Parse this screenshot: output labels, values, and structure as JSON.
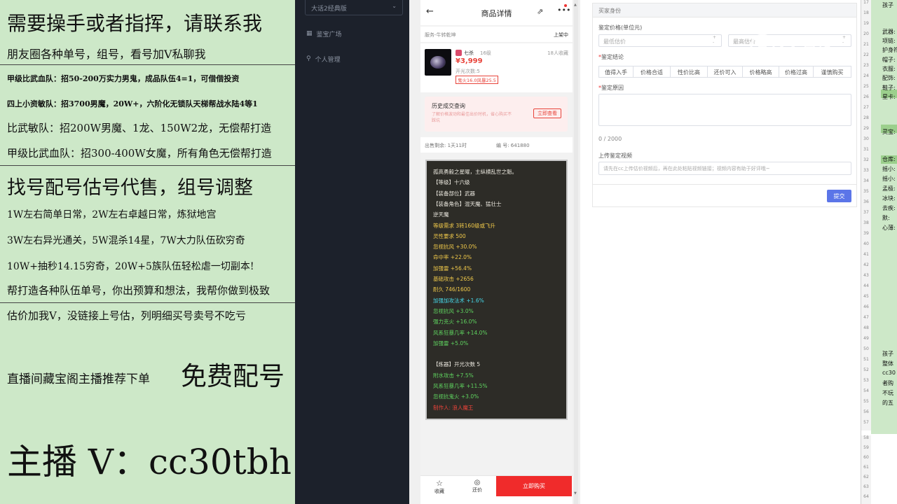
{
  "promo": {
    "l1": "需要操手或者指挥，请联系我",
    "l2": "朋友圈各种单号，组号，看号加V私聊我",
    "l3": "甲级比武血队：招50-200万实力男鬼，成品队伍4=1，可借借投资",
    "l4": "四上小资敏队：招3700男魔，20W+，六阶化无锁队天梯帮战水陆4等1",
    "l5": "比武敏队：招200W男魔、1龙、150W2龙，无偿帮打造",
    "l6": "甲级比武血队：招300-400W女魔，所有角色无偿帮打造",
    "l7": "找号配号估号代售，组号调整",
    "l8": "1W左右简单日常，2W左右卓越日常，炼狱地宫",
    "l9": "3W左右异光通关，5W混杀14星，7W大力队伍砍穷奇",
    "l10": "10W+抽秒14.15穷奇，20W+5族队伍轻松虐一切副本!",
    "l11": "帮打造各种队伍单号，你出预算和想法，我帮你做到极致",
    "l12": "估价加我V，没链接上号估，列明细买号卖号不吃亏",
    "l13a": "直播间藏宝阁主播推荐下单",
    "l13b": "免费配号",
    "l14": "主播 V：cc30tbh"
  },
  "sidebar": {
    "select_value": "大话2经典版",
    "items": [
      {
        "label": "鉴宝广场",
        "icon": "square-icon"
      },
      {
        "label": "个人管理",
        "icon": "person-icon"
      }
    ]
  },
  "phone": {
    "title": "商品详情",
    "server": "服务-牛转乾坤",
    "status": "上架中",
    "item": {
      "name": "七杀",
      "level": "16级",
      "price": "¥3,999",
      "collectors": "18人收藏",
      "times": "开光次数:5",
      "tag": "鬼火16.0风暴25.5"
    },
    "history": {
      "title": "历史成交查询",
      "desc": "了解价格波动和最佳出价时机，省心购买不踩坑",
      "btn": "立即查看"
    },
    "meta": {
      "time": "出售剩余: 1天11时",
      "id": "编 号: 641880"
    },
    "detail_lines": [
      {
        "text": "孤高勇毅之星曜，主纵横乱世之魁。",
        "color": "#e9e6dd"
      },
      {
        "text": "【等级】十六级",
        "color": "#e9e6dd"
      },
      {
        "text": "【装备部位】武器",
        "color": "#e9e6dd"
      },
      {
        "text": "【装备角色】混天魔、猛壮士",
        "color": "#e9e6dd"
      },
      {
        "text": "逆天魔",
        "color": "#e9e6dd"
      },
      {
        "text": "等级需求 3转160级或飞升",
        "color": "#f0c94a"
      },
      {
        "text": "灵性要求 500",
        "color": "#f0c94a"
      },
      {
        "text": "忽视抗风 +30.0%",
        "color": "#f0c94a"
      },
      {
        "text": "命中率 +22.0%",
        "color": "#f0c94a"
      },
      {
        "text": "加强雷 +56.4%",
        "color": "#f0c94a"
      },
      {
        "text": "基础攻击 +2656",
        "color": "#f0c94a"
      },
      {
        "text": "耐久 746/1600",
        "color": "#f0c94a"
      },
      {
        "text": "加强加攻法术 +1.6%",
        "color": "#46d7e8"
      },
      {
        "text": "忽视抗风 +3.0%",
        "color": "#5fd35f"
      },
      {
        "text": "强力克火 +16.0%",
        "color": "#5fd35f"
      },
      {
        "text": "风系狂暴几率 +14.0%",
        "color": "#5fd35f"
      },
      {
        "text": "加强雷 +5.0%",
        "color": "#5fd35f"
      },
      {
        "text": "",
        "color": "#e9e6dd"
      },
      {
        "text": "【炼器】开光次数 5",
        "color": "#e9e6dd"
      },
      {
        "text": "附水攻击 +7.5%",
        "color": "#5fd35f"
      },
      {
        "text": "风系狂暴几率 +11.5%",
        "color": "#5fd35f"
      },
      {
        "text": "忽视抗鬼火 +3.0%",
        "color": "#5fd35f"
      },
      {
        "text": "制作人: 浪人魔王",
        "color": "#e8433a"
      }
    ],
    "footer": {
      "collect": "收藏",
      "bargain": "还价",
      "buy": "立即购买"
    }
  },
  "form": {
    "head": "买家身份",
    "price_label": "鉴定价格(单位元)",
    "min_placeholder": "最低估价",
    "max_placeholder": "最高估价",
    "conclusion_label": "鉴定结论",
    "chips": [
      "值得入手",
      "价格合适",
      "性价比高",
      "还价可入",
      "价格略高",
      "价格过高",
      "谨慎购买"
    ],
    "reason_label": "鉴定原因",
    "counter": "0 / 2000",
    "video_label": "上传鉴定视频",
    "video_placeholder": "请先在cc上传估价视频后，再在此处粘贴视频链接；视频内容有助于好评哦~",
    "submit": "提交"
  },
  "watermark": "CC直播",
  "sheet": {
    "rows": [
      "17",
      "18",
      "19",
      "20",
      "21",
      "22",
      "23",
      "24",
      "25",
      "26",
      "27",
      "28",
      "29",
      "30",
      "31",
      "32",
      "33",
      "34",
      "35",
      "36",
      "37",
      "38",
      "39",
      "40",
      "41",
      "42",
      "43",
      "44",
      "45",
      "46",
      "47",
      "48",
      "49",
      "50",
      "51",
      "52",
      "53",
      "54",
      "55",
      "56",
      "57"
    ],
    "rows2": [
      "58",
      "59",
      "60",
      "61",
      "62",
      "63",
      "64"
    ],
    "cells": [
      "孩子",
      "武器:",
      "项链:",
      "护身符",
      "帽子:",
      "衣服:",
      "配饰:",
      "鞋子:",
      "星卡:",
      "灵宝:",
      "仓库:",
      "摇小:",
      "摇小:",
      "孟极:",
      "冰块:",
      "去疾:",
      "默:",
      "心薄:",
      "孩子",
      "整体",
      "cc30",
      "者购",
      "不玩",
      "的五"
    ]
  }
}
